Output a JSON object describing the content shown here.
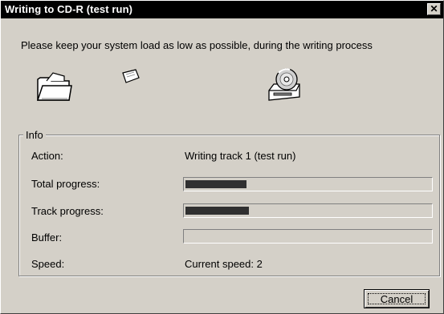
{
  "window": {
    "title": "Writing to CD-R (test run)",
    "close_glyph": "✕"
  },
  "instruction": "Please keep your system load as low as possible, during the writing process",
  "icons": [
    "folder-icon",
    "paper-sheet-icon",
    "cd-drive-icon"
  ],
  "info": {
    "legend": "Info",
    "action_label": "Action:",
    "action_value": "Writing track 1 (test run)",
    "total_progress_label": "Total progress:",
    "total_progress_fraction": 0.25,
    "track_progress_label": "Track progress:",
    "track_progress_fraction": 0.26,
    "buffer_label": "Buffer:",
    "buffer_fraction": 0,
    "speed_label": "Speed:",
    "speed_value": "Current speed: 2"
  },
  "buttons": {
    "cancel_label": "Cancel"
  },
  "colors": {
    "titlebar": "#000000",
    "dialog_bg": "#d4d0c8",
    "progress_fill": "#303030"
  }
}
